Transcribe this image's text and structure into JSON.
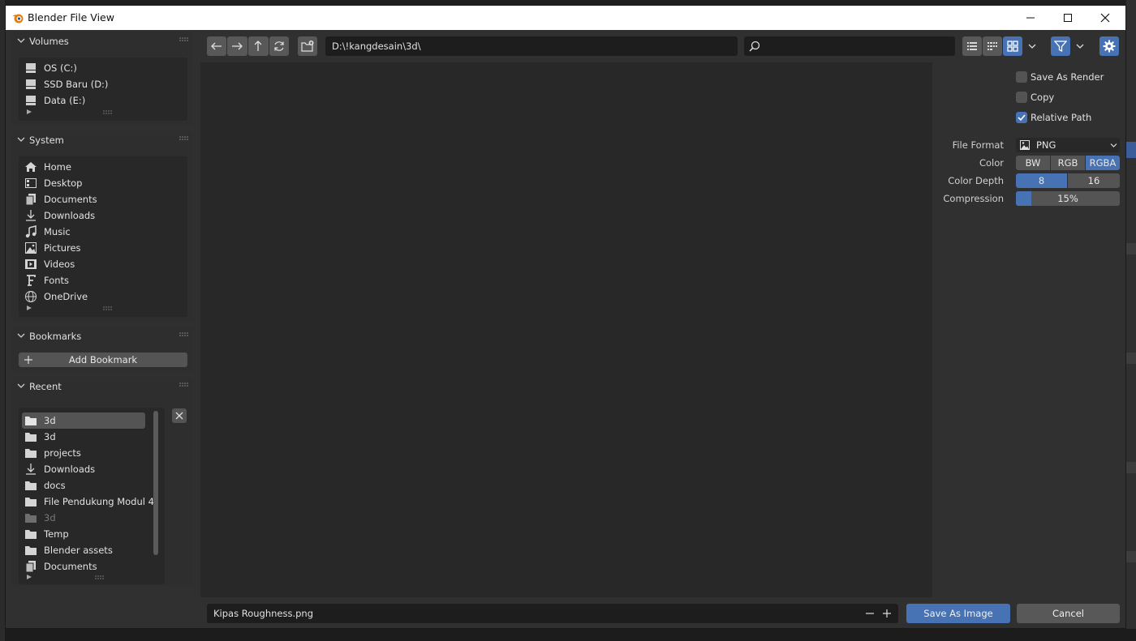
{
  "window": {
    "title": "Blender File View"
  },
  "volumes": {
    "title": "Volumes",
    "items": [
      {
        "label": "OS (C:)",
        "icon": "disk-icon"
      },
      {
        "label": "SSD Baru (D:)",
        "icon": "disk-icon"
      },
      {
        "label": "Data (E:)",
        "icon": "disk-icon"
      }
    ]
  },
  "system": {
    "title": "System",
    "items": [
      {
        "label": "Home",
        "icon": "home-icon"
      },
      {
        "label": "Desktop",
        "icon": "desktop-icon"
      },
      {
        "label": "Documents",
        "icon": "documents-icon"
      },
      {
        "label": "Downloads",
        "icon": "download-icon"
      },
      {
        "label": "Music",
        "icon": "music-icon"
      },
      {
        "label": "Pictures",
        "icon": "picture-icon"
      },
      {
        "label": "Videos",
        "icon": "video-icon"
      },
      {
        "label": "Fonts",
        "icon": "font-icon"
      },
      {
        "label": "OneDrive",
        "icon": "globe-icon"
      }
    ]
  },
  "bookmarks": {
    "title": "Bookmarks",
    "add_label": "Add Bookmark"
  },
  "recent": {
    "title": "Recent",
    "items": [
      {
        "label": "3d",
        "icon": "folder-icon",
        "selected": true
      },
      {
        "label": "3d",
        "icon": "folder-icon"
      },
      {
        "label": "projects",
        "icon": "folder-icon"
      },
      {
        "label": "Downloads",
        "icon": "download-icon"
      },
      {
        "label": "docs",
        "icon": "folder-icon"
      },
      {
        "label": "File Pendukung Modul 4",
        "icon": "folder-icon"
      },
      {
        "label": "3d",
        "icon": "folder-icon",
        "dim": true
      },
      {
        "label": "Temp",
        "icon": "folder-icon"
      },
      {
        "label": "Blender assets",
        "icon": "folder-icon"
      },
      {
        "label": "Documents",
        "icon": "documents-icon"
      }
    ]
  },
  "toolbar": {
    "path": "D:\\!kangdesain\\3d\\",
    "search_value": ""
  },
  "options": {
    "save_as_render": {
      "label": "Save As Render",
      "checked": false
    },
    "copy": {
      "label": "Copy",
      "checked": false
    },
    "relative_path": {
      "label": "Relative Path",
      "checked": true
    },
    "file_format": {
      "label": "File Format",
      "value": "PNG"
    },
    "color": {
      "label": "Color",
      "options": [
        "BW",
        "RGB",
        "RGBA"
      ],
      "selected": "RGBA"
    },
    "color_depth": {
      "label": "Color Depth",
      "options": [
        "8",
        "16"
      ],
      "selected": "8"
    },
    "compression": {
      "label": "Compression",
      "value_text": "15%",
      "fraction": 0.15
    }
  },
  "footer": {
    "filename": "Kipas Roughness.png",
    "save_label": "Save As Image",
    "cancel_label": "Cancel"
  },
  "colors": {
    "accent": "#4772b3",
    "panel": "#2e2e2e",
    "field": "#1d1d1d"
  }
}
